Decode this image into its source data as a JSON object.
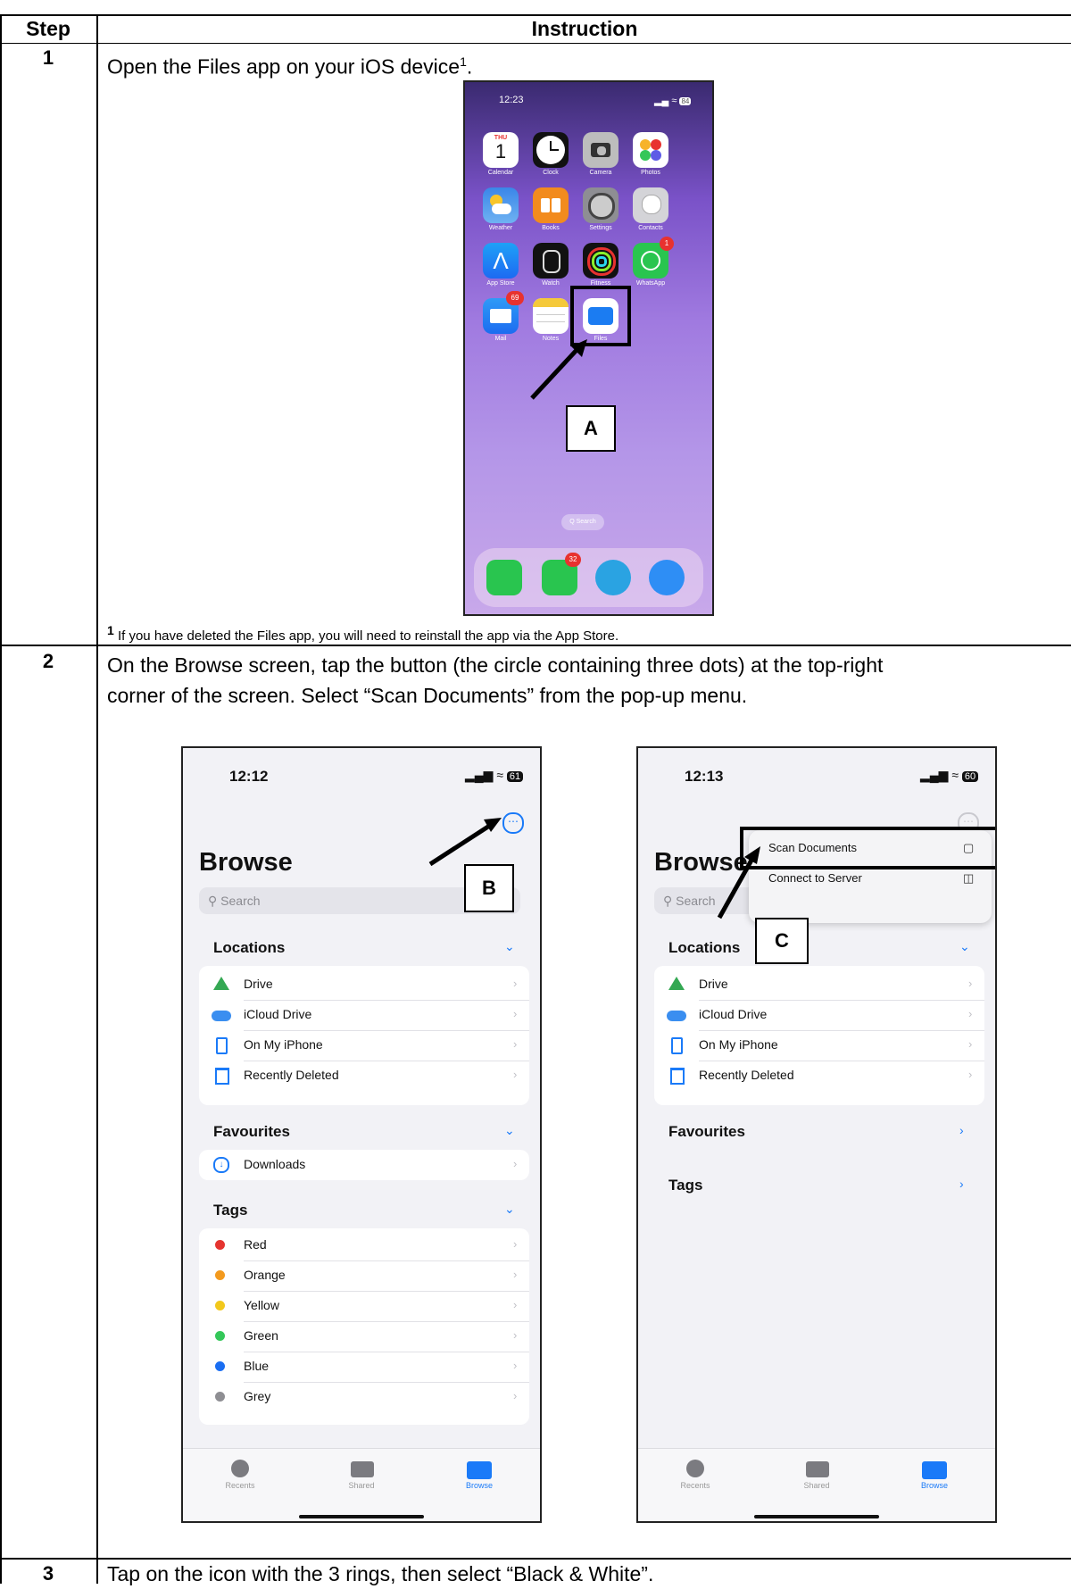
{
  "table": {
    "header_step": "Step",
    "header_instruction": "Instruction"
  },
  "step1": {
    "number": "1",
    "text": "Open the Files app on your iOS device",
    "sup": "1",
    "text_end": ".",
    "footnote_mark": "1",
    "footnote": " If you have deleted the Files app, you will need to reinstall the app via the App Store."
  },
  "home_screen": {
    "time": "12:23",
    "battery": "84",
    "calendar_day": "THU",
    "calendar_date": "1",
    "apps": [
      "Calendar",
      "Clock",
      "Camera",
      "Photos",
      "Weather",
      "Books",
      "Settings",
      "Contacts",
      "App Store",
      "Watch",
      "Fitness",
      "WhatsApp",
      "Mail",
      "Notes",
      "Files"
    ],
    "badges": {
      "whatsapp": "1",
      "mail": "69",
      "messages": "32"
    },
    "search_pill": "Q Search",
    "callout": "A"
  },
  "step2": {
    "number": "2",
    "line1": "On the Browse screen, tap the button (the circle containing three dots) at the top-right",
    "line2": "corner of the screen. Select “Scan Documents” from the pop-up menu."
  },
  "browse_left": {
    "time": "12:12",
    "battery": "61",
    "title": "Browse",
    "search": "Search",
    "locations_header": "Locations",
    "locations": [
      "Drive",
      "iCloud Drive",
      "On My iPhone",
      "Recently Deleted"
    ],
    "favourites_header": "Favourites",
    "favourites": [
      "Downloads"
    ],
    "tags_header": "Tags",
    "tags": [
      "Red",
      "Orange",
      "Yellow",
      "Green",
      "Blue",
      "Grey"
    ],
    "tab_recents": "Recents",
    "tab_shared": "Shared",
    "tab_browse": "Browse",
    "callout": "B"
  },
  "browse_right": {
    "time": "12:13",
    "battery": "60",
    "title": "Browse",
    "search": "Search",
    "menu_scan": "Scan Documents",
    "menu_connect": "Connect to Server",
    "locations_header": "Locations",
    "locations": [
      "Drive",
      "iCloud Drive",
      "On My iPhone",
      "Recently Deleted"
    ],
    "favourites_header": "Favourites",
    "tags_header": "Tags",
    "tab_recents": "Recents",
    "tab_shared": "Shared",
    "tab_browse": "Browse",
    "callout": "C"
  },
  "step3": {
    "number": "3",
    "text": "Tap on the icon with the 3 rings, then select “Black & White”."
  }
}
